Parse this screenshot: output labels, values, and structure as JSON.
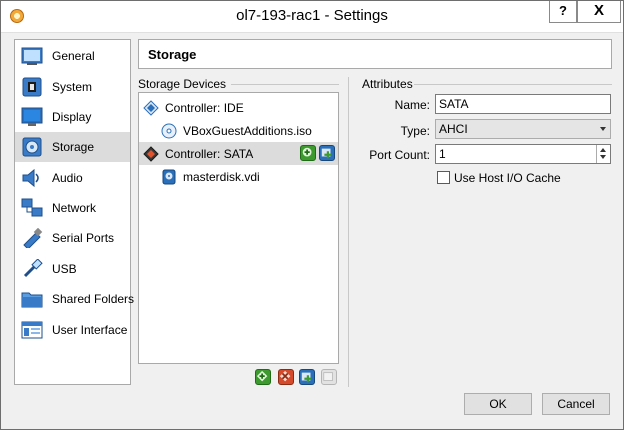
{
  "window": {
    "title": "ol7-193-rac1 - Settings",
    "help_label": "?",
    "close_label": "X"
  },
  "nav": {
    "items": [
      {
        "label": "General",
        "icon": "general-icon"
      },
      {
        "label": "System",
        "icon": "system-icon"
      },
      {
        "label": "Display",
        "icon": "display-icon"
      },
      {
        "label": "Storage",
        "icon": "storage-icon",
        "selected": true
      },
      {
        "label": "Audio",
        "icon": "audio-icon"
      },
      {
        "label": "Network",
        "icon": "network-icon"
      },
      {
        "label": "Serial Ports",
        "icon": "serial-ports-icon"
      },
      {
        "label": "USB",
        "icon": "usb-icon"
      },
      {
        "label": "Shared Folders",
        "icon": "shared-folders-icon"
      },
      {
        "label": "User Interface",
        "icon": "user-interface-icon"
      }
    ]
  },
  "header": {
    "title": "Storage"
  },
  "storage_devices": {
    "title": "Storage Devices",
    "tree": [
      {
        "label": "Controller: IDE",
        "type": "controller"
      },
      {
        "label": "VBoxGuestAdditions.iso",
        "type": "optical"
      },
      {
        "label": "Controller: SATA",
        "type": "controller",
        "selected": true
      },
      {
        "label": "masterdisk.vdi",
        "type": "disk"
      }
    ]
  },
  "attributes": {
    "title": "Attributes",
    "name_label": "Name:",
    "name_value": "SATA",
    "type_label": "Type:",
    "type_value": "AHCI",
    "port_count_label": "Port Count:",
    "port_count_value": "1",
    "host_io_cache_label": "Use Host I/O Cache",
    "host_io_cache_checked": false
  },
  "buttons": {
    "ok": "OK",
    "cancel": "Cancel"
  },
  "colors": {
    "selection": "#dcdcdc",
    "accent_blue": "#2a6fba",
    "accent_green": "#3c9a2e"
  }
}
